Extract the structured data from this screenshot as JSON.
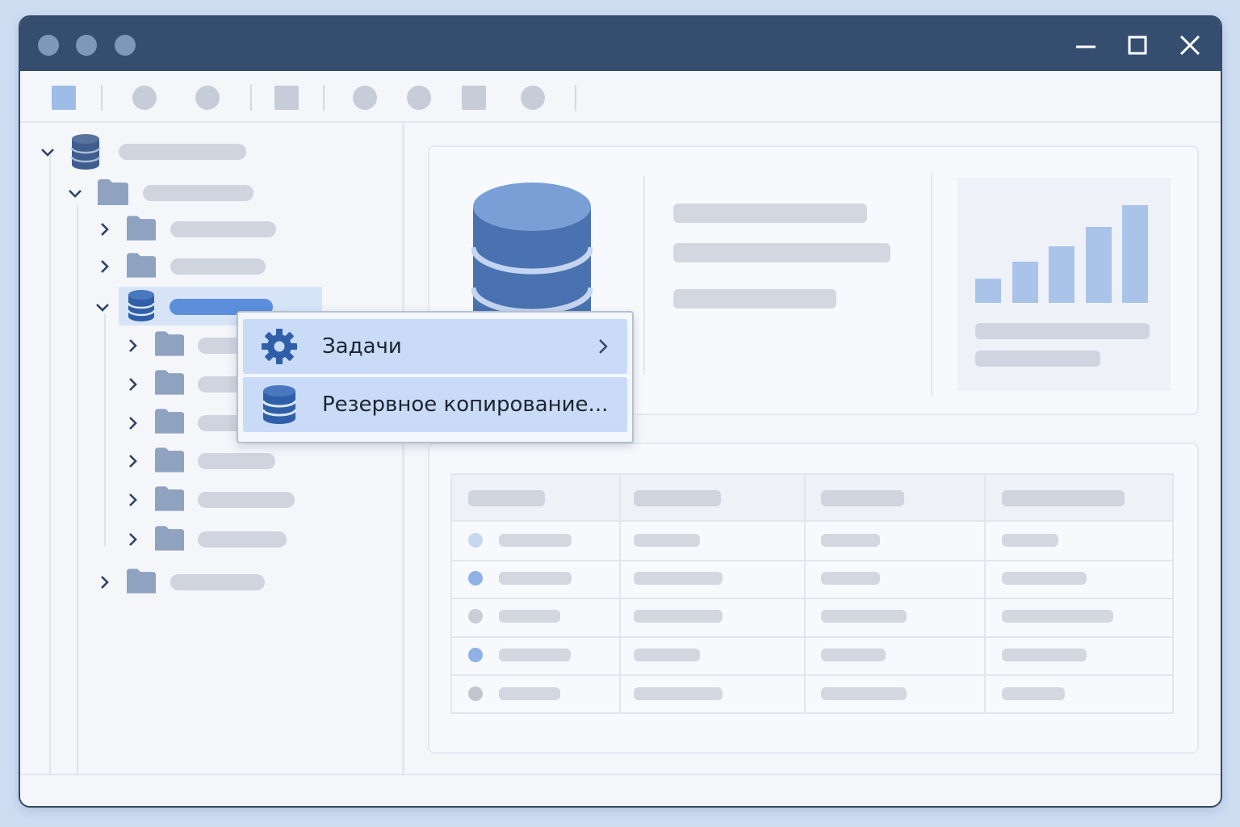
{
  "colors": {
    "titlebar": "#354e70",
    "accent": "#5b8fdb",
    "selection": "#d7e4f8",
    "menu_highlight": "#c9dbf6",
    "db_icon": "#34588f"
  },
  "titlebar": {
    "traffic_dots": [
      "circle-icon",
      "circle-icon",
      "circle-icon"
    ],
    "controls": [
      "minimize-icon",
      "maximize-icon",
      "close-icon"
    ]
  },
  "toolbar": {
    "buttons": [
      "toolbar-square-icon",
      "toolbar-circle-icon",
      "toolbar-circle-icon",
      "toolbar-square-icon",
      "toolbar-circle-icon",
      "toolbar-circle-icon",
      "toolbar-square-icon",
      "toolbar-circle-icon"
    ]
  },
  "tree": {
    "nodes": [
      {
        "icon": "database-icon",
        "expanded": true
      },
      {
        "icon": "folder-icon",
        "expanded": true
      },
      {
        "icon": "folder-icon",
        "expanded": false
      },
      {
        "icon": "folder-icon",
        "expanded": false
      },
      {
        "icon": "database-icon",
        "expanded": true,
        "selected": true
      },
      {
        "icon": "folder-icon",
        "expanded": false
      },
      {
        "icon": "folder-icon",
        "expanded": false
      },
      {
        "icon": "folder-icon",
        "expanded": false
      },
      {
        "icon": "folder-icon",
        "expanded": false
      },
      {
        "icon": "folder-icon",
        "expanded": false
      },
      {
        "icon": "folder-icon",
        "expanded": false
      },
      {
        "icon": "folder-icon",
        "expanded": false
      }
    ]
  },
  "context_menu": {
    "items": [
      {
        "label": "Задачи",
        "icon": "gear-icon",
        "has_submenu": true
      },
      {
        "label": "Резервное копирование...",
        "icon": "database-icon",
        "has_submenu": false
      }
    ]
  },
  "details": {
    "icon": "database-large-icon",
    "chart": {
      "icon": "bar-chart-icon",
      "bar_levels": [
        0.25,
        0.42,
        0.58,
        0.78,
        1.0
      ]
    }
  },
  "table": {
    "status_dots": [
      "#c6d7f1",
      "#8eb2e6",
      "#c9ced8",
      "#8eb2e6",
      "#c2c6cf"
    ]
  }
}
